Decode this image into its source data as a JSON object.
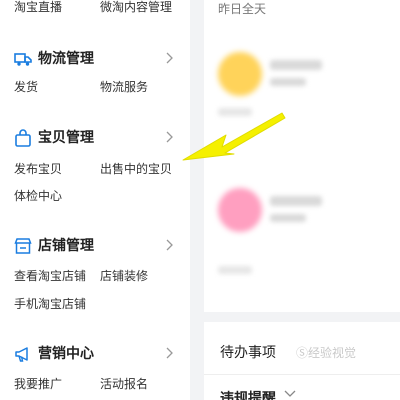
{
  "sidebar": {
    "top_links": [
      "淘宝直播",
      "微淘内容管理"
    ],
    "sections": [
      {
        "title": "物流管理",
        "icon": "truck-icon",
        "links": [
          "发货",
          "物流服务"
        ]
      },
      {
        "title": "宝贝管理",
        "icon": "bag-icon",
        "links": [
          "发布宝贝",
          "出售中的宝贝",
          "体检中心"
        ]
      },
      {
        "title": "店铺管理",
        "icon": "store-icon",
        "links": [
          "查看淘宝店铺",
          "店铺装修",
          "手机淘宝店铺"
        ]
      },
      {
        "title": "营销中心",
        "icon": "megaphone-icon",
        "links": [
          "我要推广",
          "活动报名"
        ]
      }
    ]
  },
  "main": {
    "stats_label": "昨日全天",
    "todo_title": "待办事项",
    "violation_title": "违规提醒"
  },
  "watermark": {
    "text": "Ⓢ经验视觉"
  },
  "colors": {
    "accent": "#1a7de0",
    "annotation_arrow": "#f5f000",
    "avatar_yellow": "#ffd35a",
    "avatar_pink": "#ff9fc0"
  }
}
